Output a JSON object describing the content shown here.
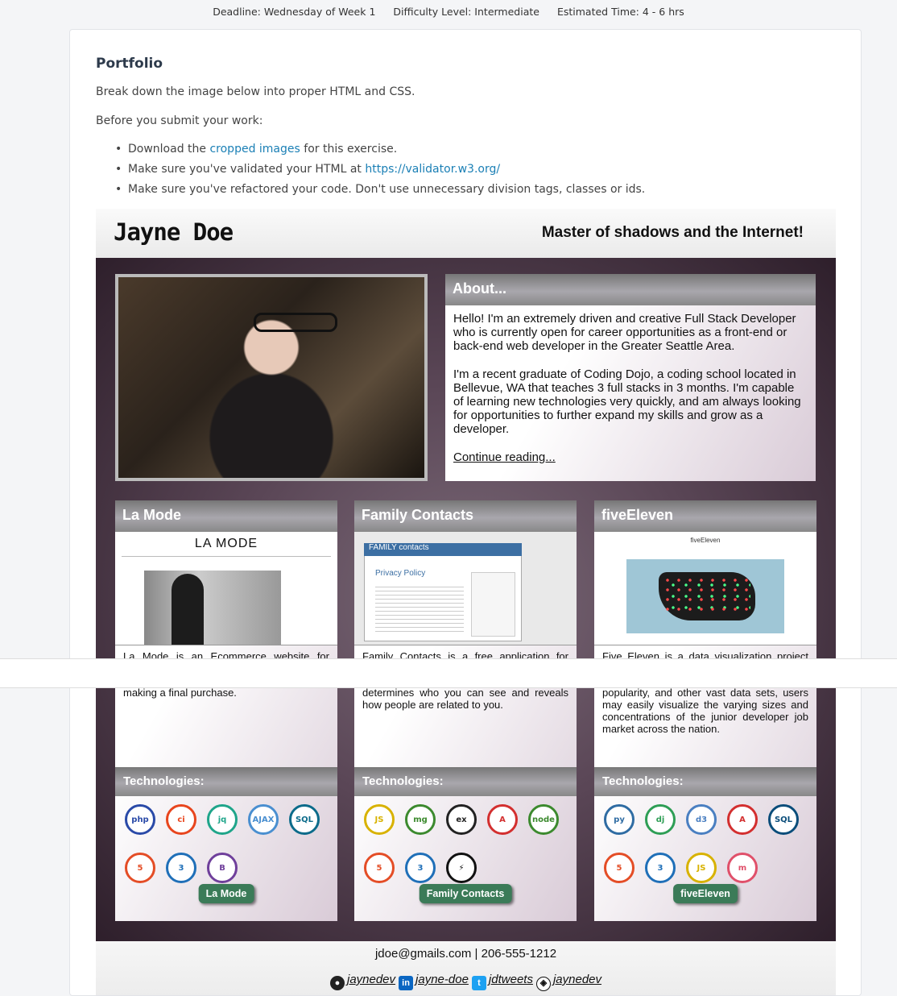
{
  "meta": {
    "deadline": "Deadline: Wednesday of Week 1",
    "difficulty": "Difficulty Level: Intermediate",
    "time": "Estimated Time: 4 - 6 hrs"
  },
  "assignment": {
    "title": "Portfolio",
    "intro": "Break down the image below into proper HTML and CSS.",
    "before": "Before you submit your work:",
    "bullets": {
      "b1_pre": "Download the ",
      "b1_link": "cropped images",
      "b1_post": " for this exercise.",
      "b2_pre": "Make sure you've validated your HTML at ",
      "b2_link": "https://validator.w3.org/",
      "b3": "Make sure you've refactored your code. Don't use unnecessary division tags, classes or ids."
    }
  },
  "mock": {
    "name": "Jayne Doe",
    "tagline": "Master of shadows and the Internet!",
    "about": {
      "title": "About...",
      "p1": "Hello! I'm an extremely driven and creative Full Stack Developer who is currently open for career opportunities as a front-end or back-end web developer in the Greater Seattle Area.",
      "p2": "I'm a recent graduate of Coding Dojo, a coding school located in Bellevue, WA that teaches 3 full stacks in 3 months. I'm capable of learning new technologies very quickly, and am always looking for opportunities to further expand my skills and grow as a developer.",
      "more": "Continue reading..."
    },
    "projects": [
      {
        "title": "La Mode",
        "shot_label": "LA MODE",
        "desc": "La Mode is an Ecommerce website for available garments, select their desired quantitiy, and compile a shopping cart for making a final purchase.",
        "tech_title": "Technologies:",
        "icons": [
          {
            "label": "php",
            "color": "#2a4aa8"
          },
          {
            "label": "ci",
            "color": "#e8451d"
          },
          {
            "label": "jq",
            "color": "#1fa58a"
          },
          {
            "label": "AJAX",
            "color": "#4a8fd0"
          },
          {
            "label": "SQL",
            "color": "#0b6b8a"
          },
          {
            "label": "5",
            "color": "#e44d26"
          },
          {
            "label": "3",
            "color": "#1f6fb8"
          },
          {
            "label": "B",
            "color": "#6f3f9b"
          }
        ],
        "button": "La Mode"
      },
      {
        "title": "Family Contacts",
        "shot_label": "FAMILY contacts",
        "shot_sub": "Privacy Policy",
        "desc": "Family Contacts is a free application for immediate family. As an essential feature of the project, your log-in information determines who you can see and reveals how people are related to you.",
        "tech_title": "Technologies:",
        "icons": [
          {
            "label": "JS",
            "color": "#d8b200"
          },
          {
            "label": "mg",
            "color": "#3c8a2e"
          },
          {
            "label": "ex",
            "color": "#222222"
          },
          {
            "label": "A",
            "color": "#d32f2f"
          },
          {
            "label": "node",
            "color": "#3c8a2e"
          },
          {
            "label": "5",
            "color": "#e44d26"
          },
          {
            "label": "3",
            "color": "#1f6fb8"
          },
          {
            "label": "⚡",
            "color": "#111111"
          }
        ],
        "button": "Family Contacts"
      },
      {
        "title": "fiveEleven",
        "shot_label": "fiveEleven",
        "desc": "Five Eleven is a data visualization project hunt into a more visual, user friendly experience. Based on location, technology popularity, and other vast data sets, users may easily visualize the varying sizes and concentrations of the junior developer job market across the nation.",
        "tech_title": "Technologies:",
        "icons": [
          {
            "label": "py",
            "color": "#2f6ca3"
          },
          {
            "label": "dj",
            "color": "#2e9e55"
          },
          {
            "label": "d3",
            "color": "#4a7fc1"
          },
          {
            "label": "A",
            "color": "#d32f2f"
          },
          {
            "label": "SQL",
            "color": "#0a4d7a"
          },
          {
            "label": "5",
            "color": "#e44d26"
          },
          {
            "label": "3",
            "color": "#1f6fb8"
          },
          {
            "label": "JS",
            "color": "#d8b200"
          },
          {
            "label": "m",
            "color": "#e0506a"
          }
        ],
        "button": "fiveEleven"
      }
    ],
    "footer": {
      "contact": "jdoe@gmails.com | 206-555-1212",
      "github": "jaynedev",
      "linkedin": "jayne-doe",
      "twitter": "jdtweets",
      "codepen": "jaynedev"
    }
  }
}
